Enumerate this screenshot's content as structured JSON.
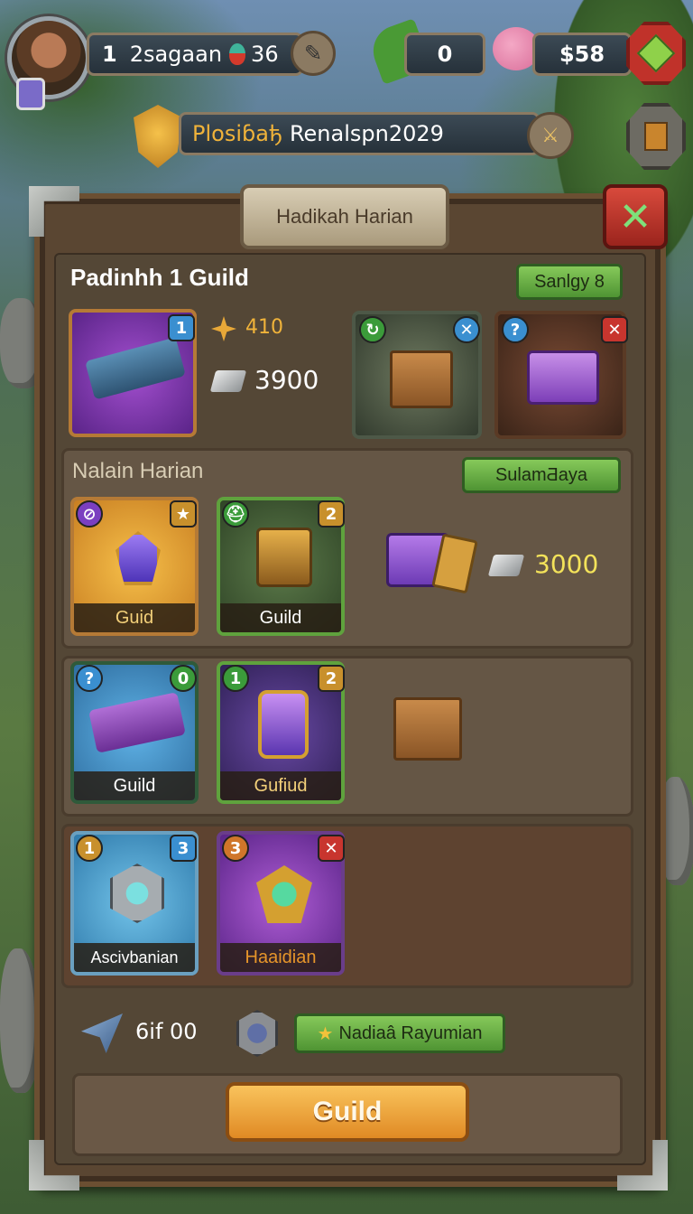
{
  "topbar": {
    "level_text": "1",
    "player_name": "2sagaan",
    "potion_count": "36",
    "leaf_count": "0",
    "money": "$58"
  },
  "banner": {
    "title_gold": "Plosiɓaђ",
    "title_white": "Renalspn2029"
  },
  "panel": {
    "header_title": "Hadikah Harian",
    "guild_title": "Padinhh 1 Guild",
    "top_right_button": "Sanlgy 8",
    "row1": {
      "rank_badge": "1",
      "coin_value": "410",
      "silver_value": "3900"
    },
    "section2": {
      "title": "Nalain Harian",
      "button": "SulamƋaya",
      "cards": [
        {
          "label": "Guid",
          "badge": ""
        },
        {
          "label": "Guild",
          "badge": "2"
        }
      ],
      "reward_value": "3000"
    },
    "section3": {
      "cards": [
        {
          "label": "Guild",
          "badge": "0"
        },
        {
          "label": "Gufiud",
          "badge_left": "1",
          "badge_right": "2"
        }
      ]
    },
    "section4": {
      "cards": [
        {
          "label": "Ascivbanian",
          "badge_left": "1",
          "badge_right": "3"
        },
        {
          "label": "Haaidian",
          "badge_left": "3"
        }
      ]
    },
    "footer": {
      "sword_value": "6if 00",
      "reward_button": "Nadiaâ Rayumian",
      "main_button": "Guild"
    }
  },
  "colors": {
    "gold_text": "#f3d07a",
    "green_button": "#5aa83c",
    "orange_button": "#f0a43a",
    "close_red": "#c8352e"
  },
  "icons": [
    "avatar",
    "potion-icon",
    "leaf-icon",
    "pig-icon",
    "green-gem-icon",
    "shield-emblem-icon",
    "sword-icon",
    "book-icon",
    "close-icon",
    "coin-icon",
    "silver-bar-icon",
    "chest-icon",
    "gem-box-icon",
    "arrow-icon",
    "helmet-icon",
    "star-icon"
  ]
}
